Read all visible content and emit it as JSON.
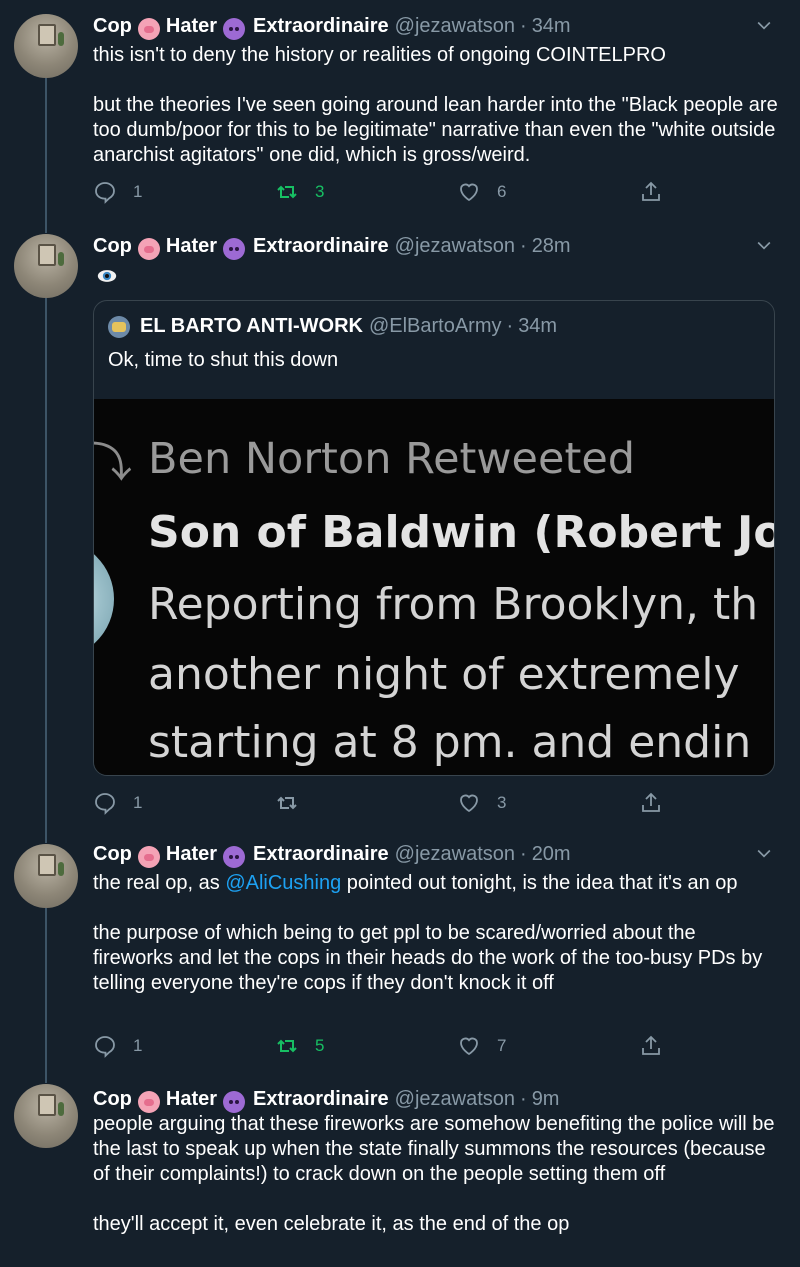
{
  "author": {
    "name_part1": "Cop",
    "name_part2": "Hater",
    "name_part3": "Extraordinaire",
    "handle": "@jezawatson",
    "pig_emoji": "pig-face-icon",
    "devil_emoji": "smiling-devil-icon"
  },
  "colors": {
    "background": "#15202b",
    "secondary_text": "#8899a6",
    "link": "#1da1f2",
    "retweet_active": "#17bf63",
    "thread_line": "#3d5466"
  },
  "tweets": [
    {
      "time": "34m",
      "text": "this isn't to deny the history or realities of ongoing COINTELPRO\n\nbut the theories I've seen going around lean harder into the \"Black people are too dumb/poor for this to be legitimate\" narrative than even the \"white outside anarchist agitators\" one did, which is gross/weird.",
      "replies": "1",
      "retweets": "3",
      "likes": "6"
    },
    {
      "time": "28m",
      "text_emoji": "eye-icon",
      "replies": "1",
      "retweets": "",
      "likes": "3",
      "quote": {
        "name": "EL BARTO ANTI-WORK",
        "handle": "@ElBartoArmy",
        "time": "34m",
        "text": "Ok, time to shut this down",
        "image_lines": [
          "Ben Norton Retweeted",
          "Son of Baldwin (Robert Jo",
          "Reporting from Brooklyn, th",
          "another night of extremely",
          "starting at 8 pm. and endin"
        ]
      }
    },
    {
      "time": "20m",
      "text_before_mention": "the real op, as ",
      "mention": "@AliCushing",
      "text_after_mention": " pointed out tonight, is the idea that it's an op\n\nthe purpose of which being to get ppl to be scared/worried about the fireworks and let the cops in their heads do the work of the too-busy PDs by telling everyone they're cops if they don't knock it off",
      "replies": "1",
      "retweets": "5",
      "likes": "7"
    },
    {
      "time": "9m",
      "text": "people arguing that these fireworks are somehow benefiting the police will be the last to speak up when the state finally summons the resources (because of their complaints!) to crack down on the people setting them off\n\nthey'll accept it, even celebrate it, as the end of the op"
    }
  ],
  "separator": "·"
}
